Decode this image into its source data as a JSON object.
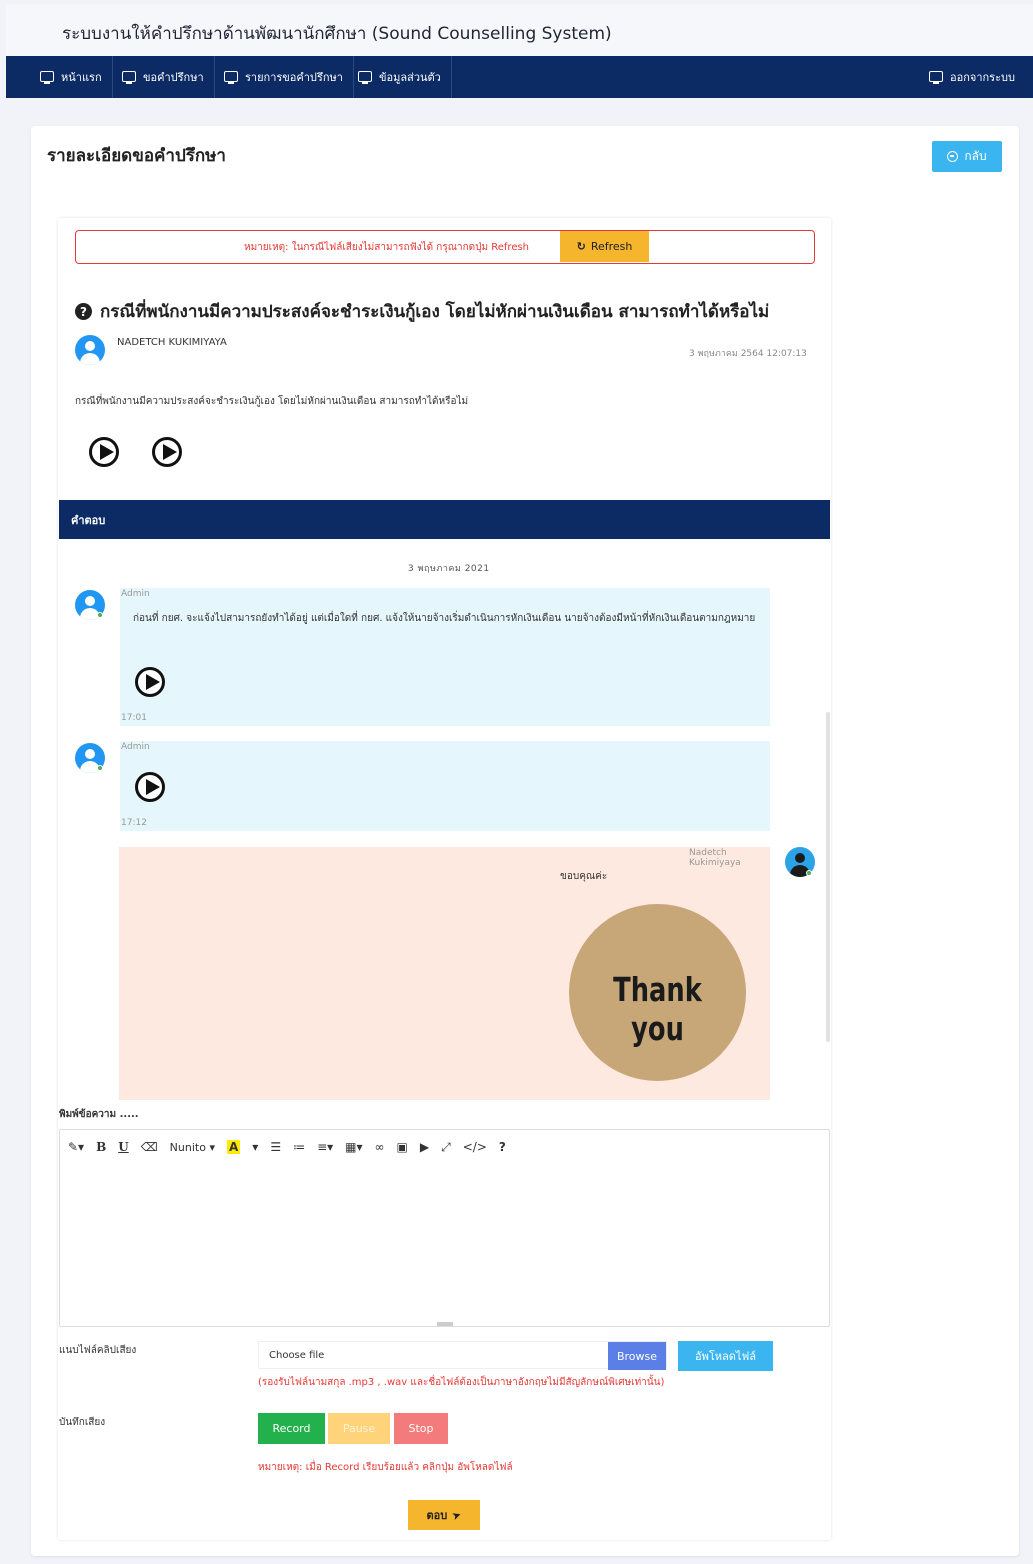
{
  "app": {
    "title": "ระบบงานให้คำปรึกษาด้านพัฒนานักศึกษา (Sound Counselling System)"
  },
  "nav": {
    "items": [
      {
        "label": "หน้าแรก",
        "icon": "monitor-icon"
      },
      {
        "label": "ขอคำปรึกษา",
        "icon": "monitor-icon"
      },
      {
        "label": "รายการขอคำปรึกษา",
        "icon": "monitor-icon"
      },
      {
        "label": "ข้อมูลส่วนตัว",
        "icon": "monitor-icon"
      }
    ],
    "logout": "ออกจากระบบ"
  },
  "page": {
    "title": "รายละเอียดขอคำปรึกษา",
    "back_label": "กลับ"
  },
  "notice": {
    "text": "หมายเหตุ: ในกรณีไฟล์เสียงไม่สามารถฟังได้ กรุณากดปุ่ม Refresh",
    "refresh_label": "Refresh"
  },
  "question": {
    "title": "กรณีที่พนักงานมีความประสงค์จะชำระเงินกู้เอง โดยไม่หักผ่านเงินเดือน สามารถทำได้หรือไม่",
    "author": "NADETCH KUKIMIYAYA",
    "date": "3 พฤษภาคม 2564 12:07:13",
    "body": "กรณีที่พนักงานมีความประสงค์จะชำระเงินกู้เอง โดยไม่หักผ่านเงินเดือน สามารถทำได้หรือไม่"
  },
  "answers": {
    "header": "คำตอบ",
    "date": "3 พฤษภาคม 2021",
    "messages": [
      {
        "sender": "Admin",
        "text": "ก่อนที่ กยศ. จะแจ้งไปสามารถยังทำได้อยู่ แต่เมื่อใดที่ กยศ. แจ้งให้นายจ้างเริ่มดำเนินการหักเงินเดือน นายจ้างต้องมีหน้าที่หักเงินเดือนตามกฎหมาย",
        "time": "17:01"
      },
      {
        "sender": "Admin",
        "text": "",
        "time": "17:12"
      },
      {
        "sender": "Nadetch Kukimiyaya",
        "text": "ขอบคุณค่ะ",
        "sticker_text": "Thank you"
      }
    ]
  },
  "compose": {
    "label": "พิมพ์ข้อความ .....",
    "font": "Nunito",
    "attach_label": "แนบไฟล์คลิปเสียง",
    "file_placeholder": "Choose file",
    "browse_label": "Browse",
    "upload_label": "อัพโหลดไฟล์",
    "file_note": "(รองรับไฟล์นามสกุล .mp3 , .wav และชื่อไฟล์ต้องเป็นภาษาอังกฤษไม่มีสัญลักษณ์พิเศษเท่านั้น)",
    "record_label": "บันทึกเสียง",
    "record": "Record",
    "pause": "Pause",
    "stop": "Stop",
    "record_note": "หมายเหตุ: เมื่อ Record เรียบร้อยแล้ว คลิกปุ่ม อัพโหลดไฟล์",
    "send_label": "ตอบ"
  },
  "colors": {
    "navbar": "#0c2a63",
    "accent": "#3bb5f0",
    "warning": "#f5b52c",
    "danger": "#e53935",
    "record": "#22b14c",
    "pause": "#ffd37a",
    "stop": "#f47b7b"
  }
}
